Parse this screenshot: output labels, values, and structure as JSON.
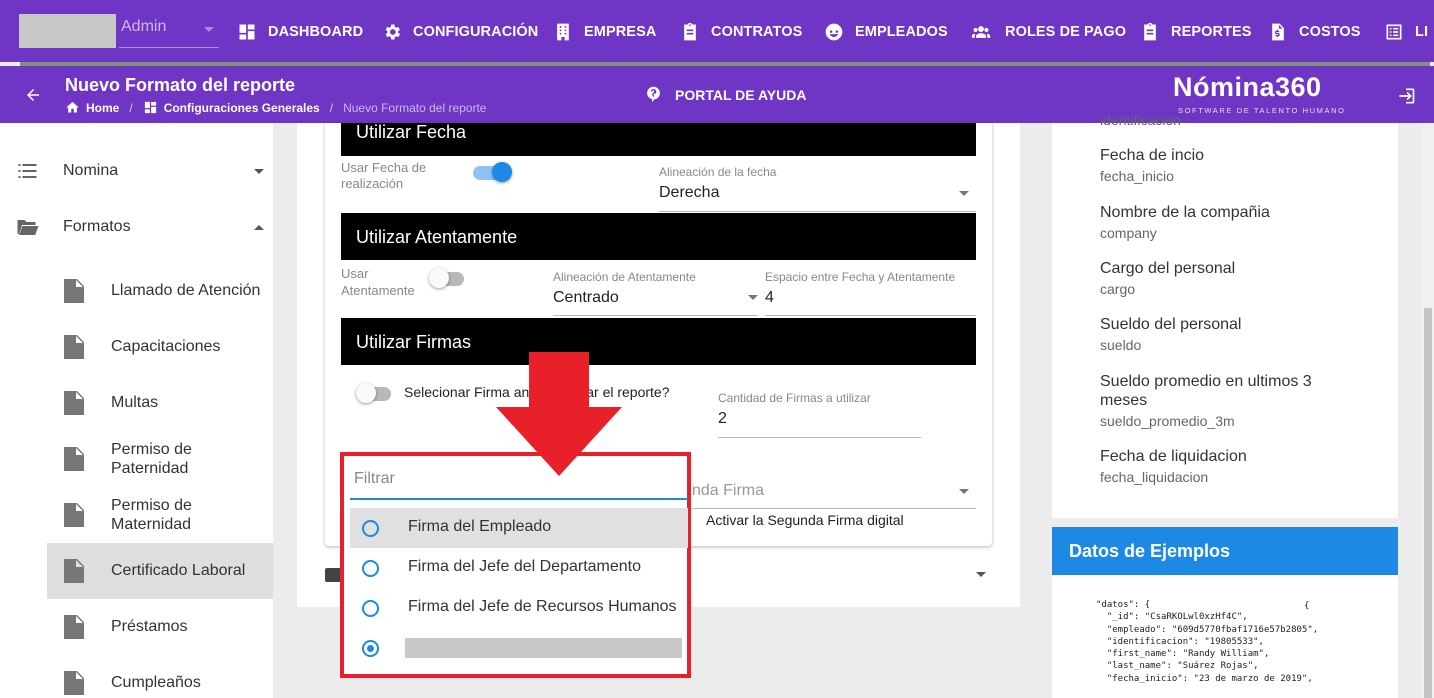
{
  "topbar": {
    "user_label": "Admin",
    "nav": [
      {
        "label": "DASHBOARD",
        "icon": "dashboard-icon"
      },
      {
        "label": "CONFIGURACIÓN",
        "icon": "gear-icon"
      },
      {
        "label": "EMPRESA",
        "icon": "building-icon"
      },
      {
        "label": "CONTRATOS",
        "icon": "clipboard-icon"
      },
      {
        "label": "EMPLEADOS",
        "icon": "face-icon"
      },
      {
        "label": "ROLES DE PAGO",
        "icon": "group-icon"
      },
      {
        "label": "REPORTES",
        "icon": "clipboard-icon"
      },
      {
        "label": "COSTOS",
        "icon": "invoice-icon"
      },
      {
        "label": "LI",
        "icon": "list-icon"
      }
    ]
  },
  "header": {
    "title": "Nuevo Formato del reporte",
    "breadcrumb": [
      "Home",
      "Configuraciones Generales",
      "Nuevo Formato del reporte"
    ],
    "help_label": "PORTAL DE AYUDA",
    "logo": "Nómina360",
    "logo_tagline": "SOFTWARE DE TALENTO HUMANO"
  },
  "sidebar": {
    "main_items": [
      {
        "label": "Nomina",
        "icon": "list-icon",
        "expanded": false
      },
      {
        "label": "Formatos",
        "icon": "folder-open-icon",
        "expanded": true
      }
    ],
    "sub_items": [
      {
        "label": "Llamado de Atención"
      },
      {
        "label": "Capacitaciones"
      },
      {
        "label": "Multas"
      },
      {
        "label": "Permiso de Paternidad"
      },
      {
        "label": "Permiso de Maternidad"
      },
      {
        "label": "Certificado Laboral",
        "active": true
      },
      {
        "label": "Préstamos"
      },
      {
        "label": "Cumpleaños"
      }
    ]
  },
  "form": {
    "fecha_section": {
      "title": "Utilizar Fecha",
      "toggle_label": "Usar Fecha de realización",
      "toggle_on": true,
      "align_label": "Alineación de la fecha",
      "align_value": "Derecha"
    },
    "atentamente_section": {
      "title": "Utilizar Atentamente",
      "toggle_label": "Usar Atentamente",
      "toggle_on": false,
      "align_label": "Alineación de Atentamente",
      "align_value": "Centrado",
      "space_label": "Espacio entre Fecha y Atentamente",
      "space_value": "4"
    },
    "firmas_section": {
      "title": "Utilizar Firmas",
      "toggle_label_visible": "Selecionar Firma an",
      "toggle_label_tail": "nerar el reporte?",
      "count_label": "Cantidad de Firmas a utilizar",
      "count_value": "2",
      "second_select_placeholder_visible": "nda Firma",
      "second_digital_label": "Activar la Segunda Firma digital"
    }
  },
  "dropdown": {
    "filter_placeholder": "Filtrar",
    "options": [
      {
        "label": "Firma del Empleado",
        "highlighted": true,
        "selected": false
      },
      {
        "label": "Firma del Jefe del Departamento",
        "highlighted": false,
        "selected": false
      },
      {
        "label": "Firma del Jefe de Recursos Humanos",
        "highlighted": false,
        "selected": false
      },
      {
        "label": "",
        "redacted": true,
        "selected": true
      }
    ]
  },
  "variables": [
    {
      "name": "",
      "key": "identificacion"
    },
    {
      "name": "Fecha de incio",
      "key": "fecha_inicio"
    },
    {
      "name": "Nombre de la compañia",
      "key": "company"
    },
    {
      "name": "Cargo del personal",
      "key": "cargo"
    },
    {
      "name": "Sueldo del personal",
      "key": "sueldo"
    },
    {
      "name": "Sueldo promedio en ultimos 3 meses",
      "key": "sueldo_promedio_3m"
    },
    {
      "name": "Fecha de liquidacion",
      "key": "fecha_liquidacion"
    }
  ],
  "examples": {
    "title": "Datos de Ejemplos",
    "open_brace": "{",
    "json_text": "\"datos\": {\n  \"_id\": \"CsaRKOLwl0xzHf4C\",\n  \"empleado\": \"609d5770fbaf1716e57b2805\",\n  \"identificacion\": \"19805533\",\n  \"first_name\": \"Randy William\",\n  \"last_name\": \"Suárez Rojas\",\n  \"fecha_inicio\": \"23 de marzo de 2019\","
  },
  "colors": {
    "brand_purple": "#6f35c4",
    "accent_blue": "#1e88e5",
    "annotation_red": "#e8202a"
  }
}
